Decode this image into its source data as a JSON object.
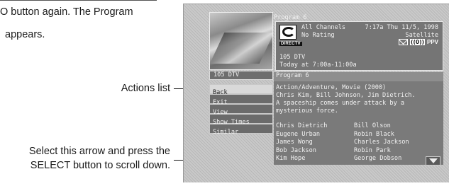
{
  "manual": {
    "intro_line_1": "O button again. The Program",
    "intro_line_2": "appears.",
    "callout_actions": "Actions list",
    "callout_scroll_1": "Select this arrow and press the",
    "callout_scroll_2": "SELECT button to scroll down."
  },
  "screen": {
    "header_title": "Program 6",
    "channel_label": "105   DTV",
    "info": {
      "line1_left": "All Channels",
      "line1_right": "7:17a Thu 11/5, 1998",
      "line2_left": "No Rating",
      "line2_right": "Satellite",
      "channel": "105  DTV",
      "airtime": "Today at 7:00a-11:00a",
      "logo_word": "DIRECTV",
      "icon_vol": "((0))",
      "icon_ppv": "PPV",
      "icons": [
        "mail-icon",
        "volume-icon",
        "ppv-icon"
      ]
    },
    "program_title": "Program 6",
    "description": [
      "Action/Adventure, Movie (2000)",
      "Chris Kim, Bill Johnson, Jim Dietrich.",
      "A spaceship comes under attack by a",
      "mysterious force."
    ],
    "cast_left": [
      "Chris Dietrich",
      "Eugene Urban",
      "James Wong",
      "Bob Jackson",
      "Kim Hope"
    ],
    "cast_right": [
      "Bill Olson",
      "Robin Black",
      "Charles Jackson",
      "Robin Park",
      "George Dobson"
    ],
    "actions": [
      "Back",
      "Exit",
      "View",
      "Show Times",
      "Similar"
    ],
    "selected_action_index": 0,
    "scroll_icon": "scroll-down-arrow-icon"
  }
}
